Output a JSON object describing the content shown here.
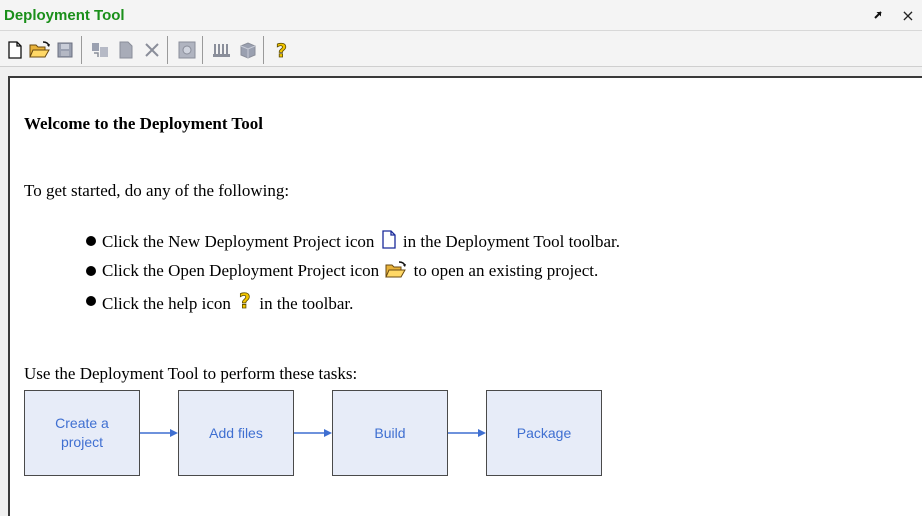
{
  "window": {
    "title": "Deployment Tool",
    "title_color": "#1a8f1a",
    "undock_icon": "undock-arrow-icon",
    "close_label": "×"
  },
  "toolbar": {
    "buttons": [
      {
        "name": "new-project",
        "icon": "new-document-icon"
      },
      {
        "name": "open-project",
        "icon": "open-folder-icon"
      },
      {
        "name": "save-project",
        "icon": "save-disk-icon"
      },
      {
        "name": "add-file",
        "icon": "add-file-icon"
      },
      {
        "name": "new-file",
        "icon": "blank-file-icon"
      },
      {
        "name": "remove",
        "icon": "delete-x-icon"
      },
      {
        "name": "settings",
        "icon": "settings-gear-icon"
      },
      {
        "name": "build",
        "icon": "build-icon"
      },
      {
        "name": "package",
        "icon": "package-box-icon"
      },
      {
        "name": "help",
        "icon": "help-question-icon"
      }
    ]
  },
  "content": {
    "heading": "Welcome to the Deployment Tool",
    "intro": "To get started, do any of the following:",
    "bullets": [
      {
        "before": "Click the New Deployment Project icon",
        "after": "in the Deployment Tool toolbar.",
        "icon": "new-document-icon"
      },
      {
        "before": "Click the Open Deployment Project icon",
        "after": "to open an existing project.",
        "icon": "open-folder-icon"
      },
      {
        "before": "Click the help icon",
        "after": "in the toolbar.",
        "icon": "help-question-icon"
      }
    ],
    "tasks_label": "Use the Deployment Tool to perform these tasks:",
    "flow": [
      {
        "label": "Create a\nproject"
      },
      {
        "label": "Add files"
      },
      {
        "label": "Build"
      },
      {
        "label": "Package"
      }
    ],
    "flow_text_color": "#3f6fd1",
    "flow_box_color": "#e7ecf8",
    "arrow_color": "#3f6fd1"
  }
}
